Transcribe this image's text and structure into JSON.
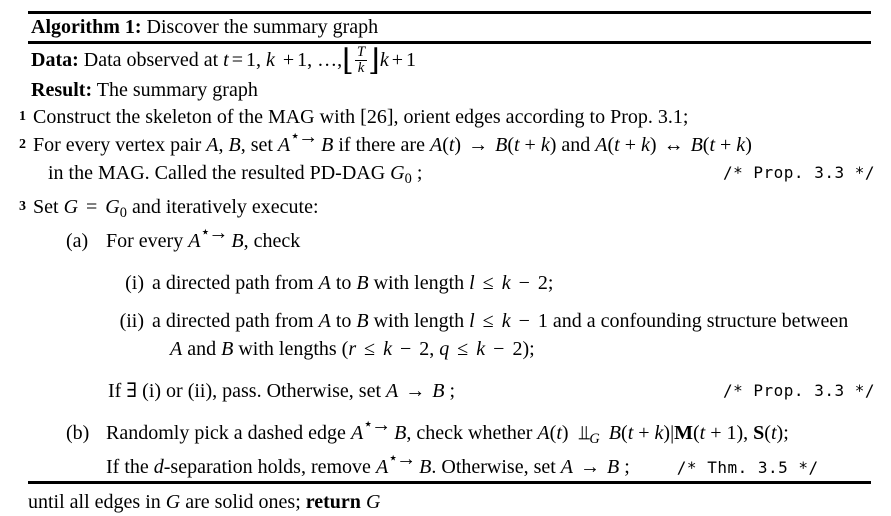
{
  "algorithm": {
    "title_label": "Algorithm 1:",
    "title_text": "Discover the summary graph",
    "data_label": "Data:",
    "data_text_pre": "Data observed at ",
    "data_math": "t = 1, k + 1, …, ⌊T/k⌋k + 1",
    "result_label": "Result:",
    "result_text": "The summary graph",
    "steps": [
      {
        "number": "1",
        "text": "Construct the skeleton of the MAG with [26], orient edges according to Prop. 3.1;"
      },
      {
        "number": "2",
        "text": "For every vertex pair A, B, set A⋆→ B if there are A(t) → B(t + k) and A(t + k) ↔ B(t + k)",
        "continuation": "in the MAG. Called the resulted PD-DAG G₀ ;",
        "comment": "/* Prop. 3.3 */"
      },
      {
        "number": "3",
        "text": "Set G = G₀ and iteratively execute:"
      }
    ],
    "sub_a": {
      "marker": "(a)",
      "text": "For every A⋆→ B, check",
      "items": [
        {
          "marker": "(i)",
          "text": "a directed path from A to B with length l ≤ k − 2;"
        },
        {
          "marker": "(ii)",
          "text": "a directed path from A to B with length l ≤ k − 1 and a confounding structure between",
          "text_line2": "A and B with lengths (r ≤ k − 2, q ≤ k − 2);"
        }
      ],
      "conclusion": "If ∃ (i) or (ii), pass. Otherwise, set A → B ;",
      "conclusion_comment": "/* Prop. 3.3 */"
    },
    "sub_b": {
      "marker": "(b)",
      "text": "Randomly pick a dashed edge A⋆→ B, check whether A(t) ⫫G B(t + k)|M(t + 1), S(t);",
      "conclusion": "If the d-separation holds, remove A⋆→ B. Otherwise, set A → B ;",
      "conclusion_comment": "/* Thm. 3.5 */"
    },
    "until_text": "until all edges in G are solid ones;",
    "return_label": "return",
    "return_var": "G"
  }
}
